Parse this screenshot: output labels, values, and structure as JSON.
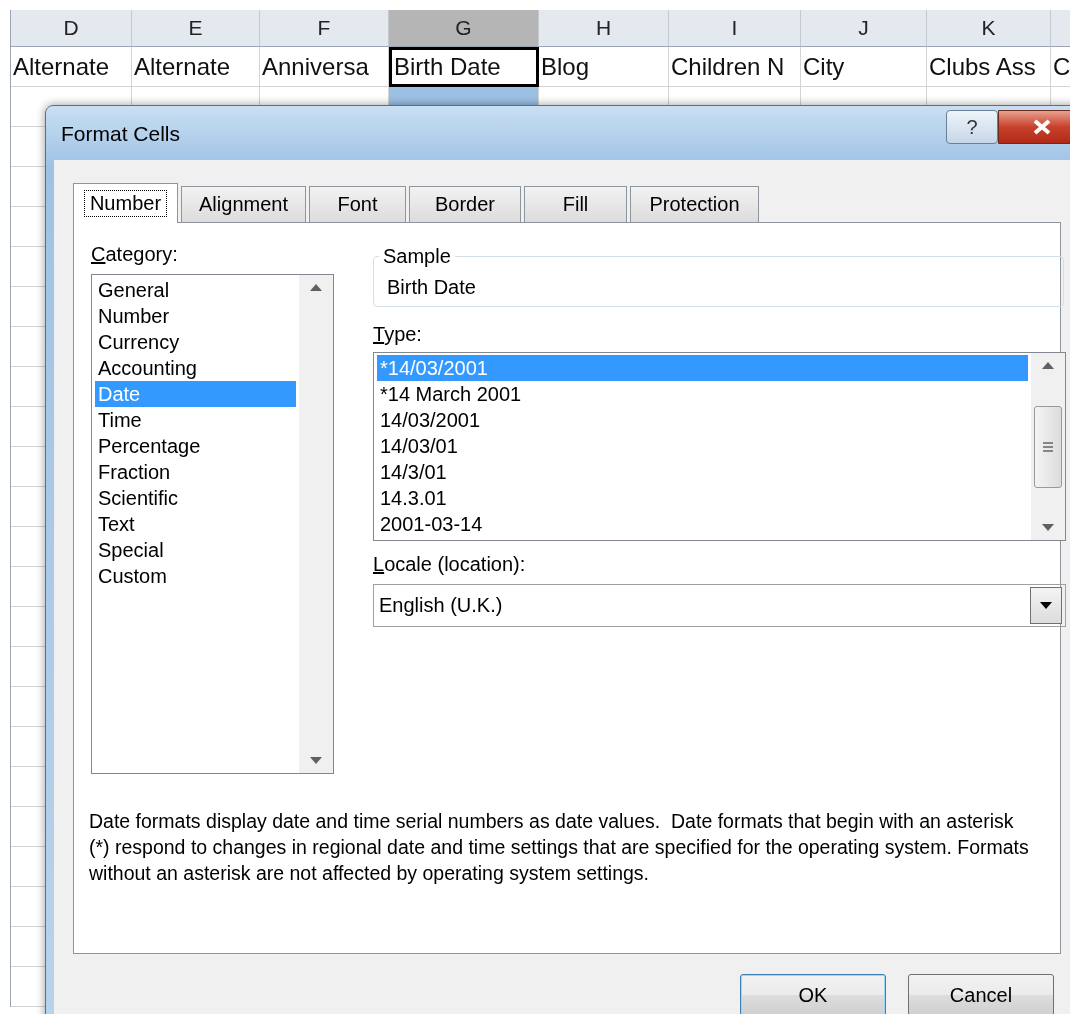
{
  "sheet": {
    "columns": [
      {
        "label": "D",
        "selected": false,
        "cell": "Alternate",
        "active": false
      },
      {
        "label": "E",
        "selected": false,
        "cell": "Alternate",
        "active": false
      },
      {
        "label": "F",
        "selected": false,
        "cell": "Anniversa",
        "active": false
      },
      {
        "label": "G",
        "selected": true,
        "cell": "Birth Date",
        "active": true
      },
      {
        "label": "H",
        "selected": false,
        "cell": "Blog",
        "active": false
      },
      {
        "label": "I",
        "selected": false,
        "cell": "Children N",
        "active": false
      },
      {
        "label": "J",
        "selected": false,
        "cell": "City",
        "active": false
      },
      {
        "label": "K",
        "selected": false,
        "cell": "Clubs Ass",
        "active": false
      },
      {
        "selected": false,
        "cell": "C",
        "active": false
      }
    ]
  },
  "dialog": {
    "title": "Format Cells",
    "help": "?",
    "tabs": [
      {
        "label": "Number",
        "selected": true
      },
      {
        "label": "Alignment",
        "selected": false
      },
      {
        "label": "Font",
        "selected": false
      },
      {
        "label": "Border",
        "selected": false
      },
      {
        "label": "Fill",
        "selected": false
      },
      {
        "label": "Protection",
        "selected": false
      }
    ],
    "category_label": "Category:",
    "categories": [
      {
        "label": "General",
        "selected": false
      },
      {
        "label": "Number",
        "selected": false
      },
      {
        "label": "Currency",
        "selected": false
      },
      {
        "label": "Accounting",
        "selected": false
      },
      {
        "label": "Date",
        "selected": true
      },
      {
        "label": "Time",
        "selected": false
      },
      {
        "label": "Percentage",
        "selected": false
      },
      {
        "label": "Fraction",
        "selected": false
      },
      {
        "label": "Scientific",
        "selected": false
      },
      {
        "label": "Text",
        "selected": false
      },
      {
        "label": "Special",
        "selected": false
      },
      {
        "label": "Custom",
        "selected": false
      }
    ],
    "sample_label": "Sample",
    "sample_value": "Birth Date",
    "type_label": "Type:",
    "types": [
      {
        "label": "*14/03/2001",
        "selected": true
      },
      {
        "label": "*14 March 2001",
        "selected": false
      },
      {
        "label": "14/03/2001",
        "selected": false
      },
      {
        "label": "14/03/01",
        "selected": false
      },
      {
        "label": "14/3/01",
        "selected": false
      },
      {
        "label": "14.3.01",
        "selected": false
      },
      {
        "label": "2001-03-14",
        "selected": false
      }
    ],
    "locale_label": "Locale (location):",
    "locale_value": "English (U.K.)",
    "description": "Date formats display date and time serial numbers as date values.  Date formats that begin with an asterisk (*) respond to changes in regional date and time settings that are specified for the operating system. Formats without an asterisk are not affected by operating system settings.",
    "buttons": [
      {
        "label": "OK",
        "kind": "default"
      },
      {
        "label": "Cancel",
        "kind": "normal"
      }
    ]
  }
}
